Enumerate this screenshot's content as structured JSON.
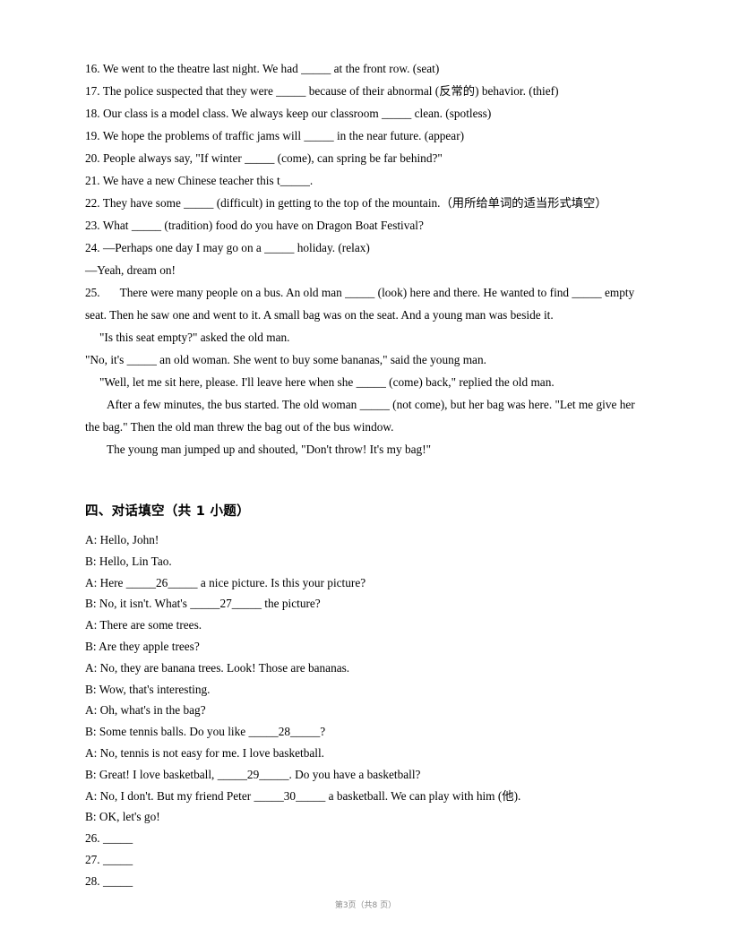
{
  "page": {
    "footer": "第3页（共8 页）"
  },
  "fill_in_blanks": {
    "items": [
      "16. We went to the theatre last night. We had _____ at the front row. (seat)",
      "17. The police suspected that they were _____ because of their abnormal (反常的) behavior. (thief)",
      "18. Our class is a model class. We always keep our classroom _____ clean. (spotless)",
      "19. We hope the problems of traffic jams will _____ in the near future. (appear)",
      "20. People always say, \"If winter _____ (come), can spring be far behind?\"",
      "21. We have a new Chinese teacher this t_____.",
      "22. They have some _____ (difficult) in getting to the top of the mountain.（用所给单词的适当形式填空）",
      "23. What _____ (tradition) food do you have on Dragon Boat Festival?",
      "24. —Perhaps one day I may go on a _____ holiday. (relax)",
      "—Yeah, dream on!"
    ]
  },
  "passage_25": {
    "number": "25.",
    "paragraphs": [
      "There were many people on a bus. An old man _____ (look) here and there. He wanted to find _____ empty seat. Then he saw one and went to it. A small bag was on the seat. And a young man was beside it.",
      "\"Is this seat empty?\" asked the old man.",
      "\"No, it's _____ an old woman. She went to buy some bananas,\" said the young man.",
      "\"Well, let me sit here, please. I'll leave here when she _____ (come) back,\" replied the old man.",
      "After a few minutes, the bus started. The old woman _____ (not come), but her bag was here. \"Let me give her the bag.\" Then the old man threw the bag out of the bus window.",
      "The young man jumped up and shouted, \"Don't throw! It's my bag!\""
    ]
  },
  "dialogue_section": {
    "heading": "四、对话填空（共 1 小题）",
    "lines": [
      "A: Hello, John!",
      "B: Hello, Lin Tao.",
      "A: Here _____26_____ a nice picture. Is this your picture?",
      "B: No, it isn't. What's _____27_____ the picture?",
      "A: There are some trees.",
      "B: Are they apple trees?",
      "A: No, they are banana trees. Look! Those are bananas.",
      "B: Wow, that's interesting.",
      "A: Oh, what's in the bag?",
      "B: Some tennis balls. Do you like _____28_____?",
      "A: No, tennis is not easy for me. I love basketball.",
      "B: Great! I love basketball, _____29_____. Do you have a basketball?",
      "A: No, I don't. But my friend Peter _____30_____ a basketball. We can play with him (他).",
      "B: OK, let's go!"
    ],
    "answer_lines": [
      "26. _____",
      "27. _____",
      "28. _____"
    ]
  }
}
